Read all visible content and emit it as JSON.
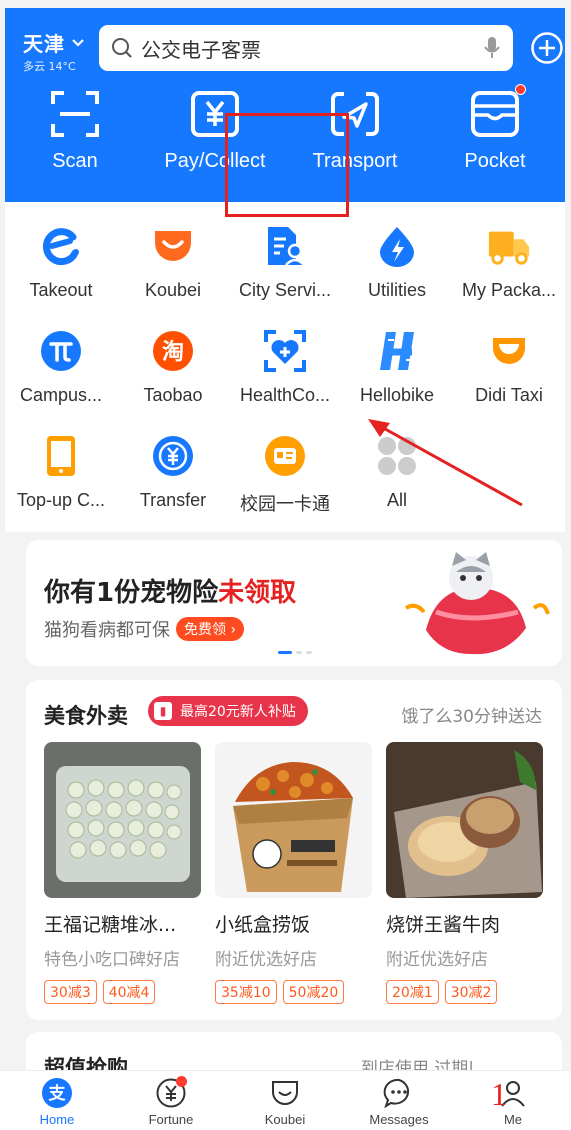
{
  "header": {
    "city": "天津",
    "weather": "多云 14°C",
    "search_placeholder": "公交电子客票",
    "quick_actions": [
      {
        "label": "Scan",
        "icon": "scan-icon"
      },
      {
        "label": "Pay/Collect",
        "icon": "yuan-icon"
      },
      {
        "label": "Transport",
        "icon": "transport-icon"
      },
      {
        "label": "Pocket",
        "icon": "pocket-icon"
      }
    ]
  },
  "apps": [
    {
      "label": "Takeout"
    },
    {
      "label": "Koubei"
    },
    {
      "label": "City Servi..."
    },
    {
      "label": "Utilities"
    },
    {
      "label": "My Packa..."
    },
    {
      "label": "Campus..."
    },
    {
      "label": "Taobao"
    },
    {
      "label": "HealthCo..."
    },
    {
      "label": "Hellobike"
    },
    {
      "label": "Didi Taxi"
    },
    {
      "label": "Top-up C..."
    },
    {
      "label": "Transfer"
    },
    {
      "label": "校园一卡通"
    },
    {
      "label": "All"
    }
  ],
  "banner": {
    "title_prefix": "你有1份宠物险",
    "title_highlight": "未领取",
    "subtitle": "猫狗看病都可保",
    "cta": "免费领"
  },
  "food": {
    "title": "美食外卖",
    "badge": "最高20元新人补贴",
    "more": "饿了么30分钟送达",
    "shops": [
      {
        "name": "王福记糖堆冰...",
        "sub": "特色小吃口碑好店",
        "tags": [
          "30减3",
          "40减4"
        ]
      },
      {
        "name": "小纸盒捞饭",
        "sub": "附近优选好店",
        "tags": [
          "35减10",
          "50减20"
        ]
      },
      {
        "name": "烧饼王酱牛肉",
        "sub": "附近优选好店",
        "tags": [
          "20减1",
          "30减2"
        ]
      }
    ]
  },
  "next_section": {
    "title": "超值抢购",
    "right": "到店使用 过期|"
  },
  "tabs": [
    {
      "label": "Home"
    },
    {
      "label": "Fortune"
    },
    {
      "label": "Koubei"
    },
    {
      "label": "Messages"
    },
    {
      "label": "Me"
    }
  ],
  "annotation_mark": "1",
  "colors": {
    "primary": "#1677ff",
    "highlight": "#e52222",
    "accent": "#ff5a1f"
  }
}
